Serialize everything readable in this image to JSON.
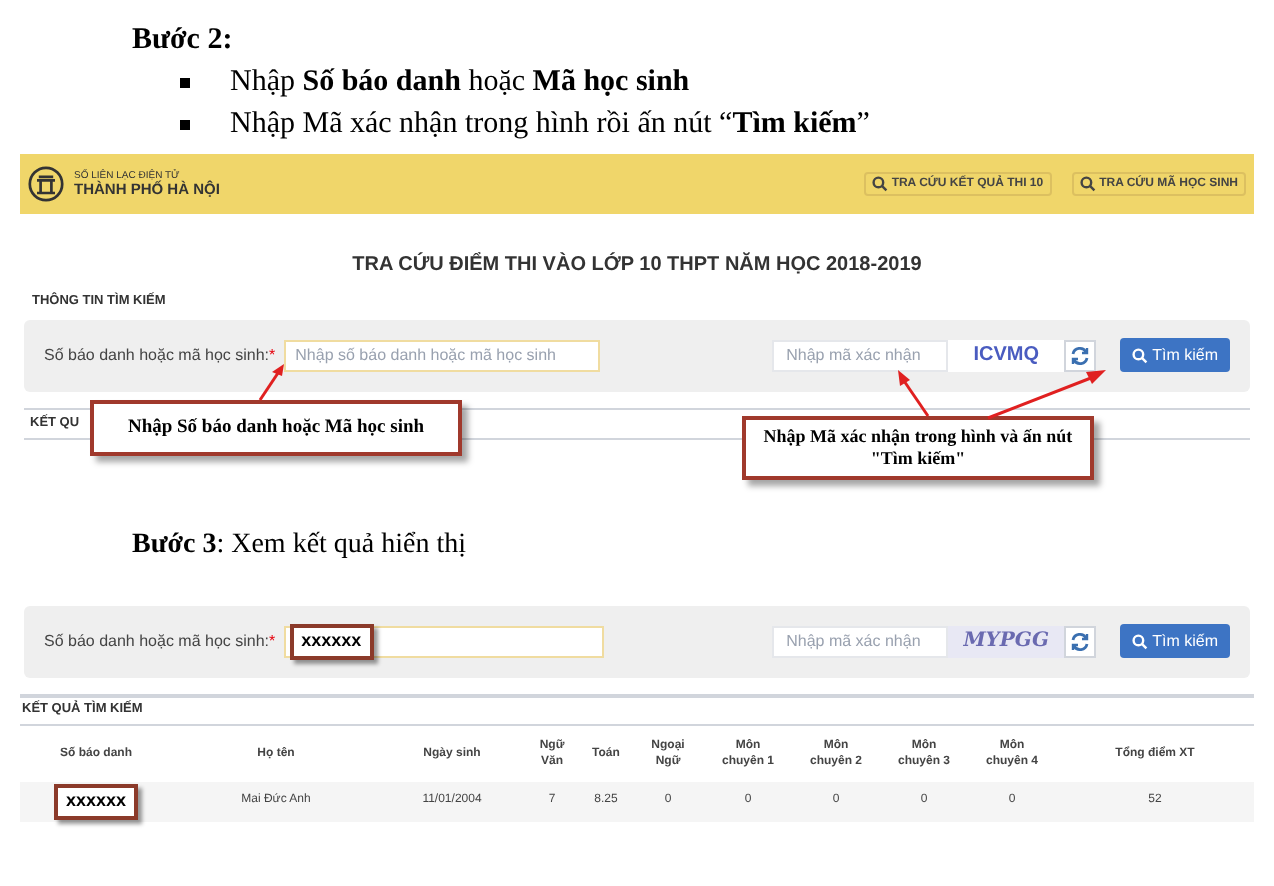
{
  "step2": {
    "heading": "Bước 2:",
    "bullets": [
      "Nhập **Số báo danh** hoặc **Mã học sinh**",
      "Nhập Mã xác nhận trong hình rồi ấn nút “**Tìm kiếm**”"
    ]
  },
  "shot1": {
    "brand_top": "SỔ LIÊN LẠC ĐIỆN TỬ",
    "brand_bottom": "THÀNH PHỐ HÀ NỘI",
    "nav": [
      "TRA CỨU KẾT QUẢ THI 10",
      "TRA CỨU MÃ HỌC SINH"
    ],
    "title": "TRA CỨU ĐIỂM THI VÀO LỚP 10 THPT NĂM HỌC 2018-2019",
    "section": "THÔNG TIN TÌM KIẾM",
    "label": "Số báo danh hoặc mã học sinh:",
    "required": "*",
    "id_placeholder": "Nhập số báo danh hoặc mã học sinh",
    "captcha_placeholder": "Nhập mã xác nhận",
    "captcha": "ICVMQ",
    "search_button": "Tìm kiếm",
    "results_partial": "KẾT QU",
    "callout_left": "Nhập Số báo danh hoặc Mã học sinh",
    "callout_right": "Nhập Mã xác nhận trong hình và ấn nút \"Tìm kiếm\""
  },
  "step3": {
    "text": "**Bước 3**: Xem kết quả hiển thị"
  },
  "shot2": {
    "label": "Số báo danh hoặc mã học sinh:",
    "required": "*",
    "id_value": "xxxxxx",
    "captcha_placeholder": "Nhập mã xác nhận",
    "captcha": "MYPGG",
    "search_button": "Tìm kiếm",
    "results_title": "KẾT QUẢ TÌM KIẾM",
    "table": {
      "columns": [
        "Số báo danh",
        "Họ tên",
        "Ngày sinh",
        "Ngữ Văn",
        "Toán",
        "Ngoại Ngữ",
        "Môn chuyên 1",
        "Môn chuyên 2",
        "Môn chuyên 3",
        "Môn chuyên 4",
        "Tổng điểm XT"
      ],
      "rows": [
        [
          "xxxxxx",
          "Mai Đức Anh",
          "11/01/2004",
          "7",
          "8.25",
          "0",
          "0",
          "0",
          "0",
          "0",
          "52"
        ]
      ]
    }
  }
}
